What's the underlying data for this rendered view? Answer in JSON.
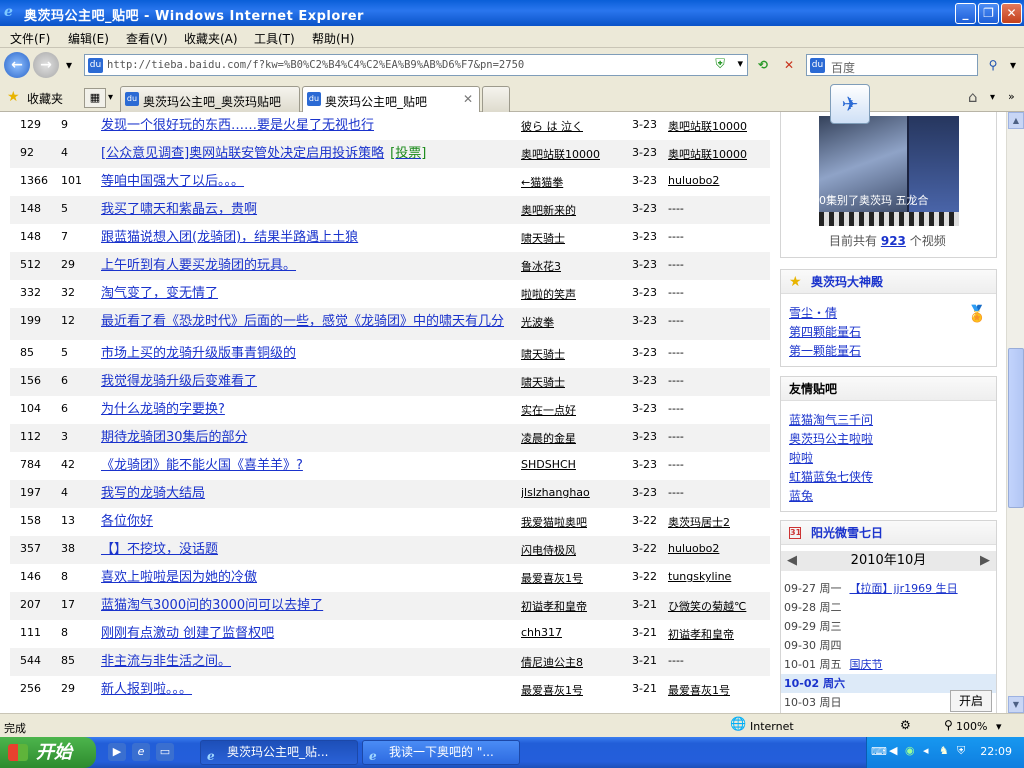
{
  "window": {
    "title": "奥茨玛公主吧_贴吧 - Windows Internet Explorer"
  },
  "menu": [
    "文件(F)",
    "编辑(E)",
    "查看(V)",
    "收藏夹(A)",
    "工具(T)",
    "帮助(H)"
  ],
  "address": {
    "url": "http://tieba.baidu.com/f?kw=%B0%C2%B4%C4%C2%EA%B9%AB%D6%F7&pn=2750"
  },
  "search": {
    "placeholder": "百度"
  },
  "favorites_label": "收藏夹",
  "tabs": [
    {
      "label": "奥茨玛公主吧_奥茨玛贴吧",
      "active": false
    },
    {
      "label": "奥茨玛公主吧_贴吧",
      "active": true
    }
  ],
  "threads": [
    {
      "replies": "129",
      "clicks": "9",
      "title": "发现一个很好玩的东西……要是火星了无视也行",
      "tag": "",
      "author": "彼ら は 泣く",
      "date": "3-23",
      "last": "奥吧站联10000"
    },
    {
      "replies": "92",
      "clicks": "4",
      "title": "[公众意见调查]奥网站联安管处决定启用投诉策略",
      "tag": "[投票]",
      "author": "奥吧站联10000",
      "date": "3-23",
      "last": "奥吧站联10000"
    },
    {
      "replies": "1366",
      "clicks": "101",
      "title": "等咱中国强大了以后。。。",
      "tag": "",
      "author": "←猫猫拳",
      "date": "3-23",
      "last": "huluobo2"
    },
    {
      "replies": "148",
      "clicks": "5",
      "title": "我买了啸天和紫晶云，贵啊",
      "tag": "",
      "author": "奥吧新来的",
      "date": "3-23",
      "last": "----"
    },
    {
      "replies": "148",
      "clicks": "7",
      "title": "跟蓝猫说想入团(龙骑团)，结果半路遇上土狼",
      "tag": "",
      "author": "啸天骑士",
      "date": "3-23",
      "last": "----"
    },
    {
      "replies": "512",
      "clicks": "29",
      "title": "上午听到有人要买龙骑团的玩具。",
      "tag": "",
      "author": "鲁冰花3",
      "date": "3-23",
      "last": "----"
    },
    {
      "replies": "332",
      "clicks": "32",
      "title": "淘气变了，变无情了",
      "tag": "",
      "author": "啦啦的笑声",
      "date": "3-23",
      "last": "----"
    },
    {
      "replies": "199",
      "clicks": "12",
      "title": "最近看了看《恐龙时代》后面的一些，感觉《龙骑团》中的啸天有几分",
      "tag": "",
      "author": "光波拳",
      "date": "3-23",
      "last": "----"
    },
    {
      "replies": "85",
      "clicks": "5",
      "title": "市场上买的龙骑升级版事青铜级的",
      "tag": "",
      "author": "啸天骑士",
      "date": "3-23",
      "last": "----"
    },
    {
      "replies": "156",
      "clicks": "6",
      "title": "我觉得龙骑升级后变难看了",
      "tag": "",
      "author": "啸天骑士",
      "date": "3-23",
      "last": "----"
    },
    {
      "replies": "104",
      "clicks": "6",
      "title": "为什么龙骑的字要换?",
      "tag": "",
      "author": "实在一点好",
      "date": "3-23",
      "last": "----"
    },
    {
      "replies": "112",
      "clicks": "3",
      "title": "期待龙骑团30集后的部分",
      "tag": "",
      "author": "凌晨的金星",
      "date": "3-23",
      "last": "----"
    },
    {
      "replies": "784",
      "clicks": "42",
      "title": "《龙骑团》能不能火国《喜羊羊》?",
      "tag": "",
      "author": "SHDSHCH",
      "date": "3-23",
      "last": "----"
    },
    {
      "replies": "197",
      "clicks": "4",
      "title": "我写的龙骑大结局",
      "tag": "",
      "author": "jlslzhanghao",
      "date": "3-23",
      "last": "----"
    },
    {
      "replies": "158",
      "clicks": "13",
      "title": "各位你好",
      "tag": "",
      "author": "我爱猫啦奥吧",
      "date": "3-22",
      "last": "奥茨玛居士2"
    },
    {
      "replies": "357",
      "clicks": "38",
      "title": "【】不挖坟，没话题",
      "tag": "",
      "author": "闪电侍极风",
      "date": "3-22",
      "last": "huluobo2"
    },
    {
      "replies": "146",
      "clicks": "8",
      "title": "喜欢上啦啦是因为她的冷傲",
      "tag": "",
      "author": "最爱喜灰1号",
      "date": "3-22",
      "last": "tungskyline"
    },
    {
      "replies": "207",
      "clicks": "17",
      "title": "蓝猫淘气3000问的3000问可以去掉了",
      "tag": "",
      "author": "初谥孝和皇帝",
      "date": "3-21",
      "last": "ひ微笑の菊越℃"
    },
    {
      "replies": "111",
      "clicks": "8",
      "title": "刚刚有点激动 创建了监督权吧",
      "tag": "",
      "author": "chh317",
      "date": "3-21",
      "last": "初谥孝和皇帝"
    },
    {
      "replies": "544",
      "clicks": "85",
      "title": "非主流与非生活之间。",
      "tag": "",
      "author": "倩尼迪公主8",
      "date": "3-21",
      "last": "----"
    },
    {
      "replies": "256",
      "clicks": "29",
      "title": "新人报到啦。。。",
      "tag": "",
      "author": "最爱喜灰1号",
      "date": "3-21",
      "last": "最爱喜灰1号"
    }
  ],
  "video": {
    "caption": "0集别了奥茨玛   五龙合",
    "count_prefix": "目前共有",
    "count": "923",
    "count_suffix": "个视频"
  },
  "temple": {
    "title": "奥茨玛大神殿",
    "items": [
      "雪尘・倩",
      "第四颗能量石",
      "第一颗能量石"
    ]
  },
  "friends": {
    "title": "友情贴吧",
    "items": [
      "蓝猫淘气三千问",
      "奥茨玛公主啦啦",
      "啦啦",
      "虹猫蓝兔七侠传",
      "蓝兔"
    ]
  },
  "calendar": {
    "title": "阳光微雪七日",
    "month": "2010年10月",
    "items": [
      {
        "day": "09-27 周一",
        "event": "【拉面】jjr1969 生日"
      },
      {
        "day": "09-28 周二",
        "event": ""
      },
      {
        "day": "09-29 周三",
        "event": ""
      },
      {
        "day": "09-30 周四",
        "event": ""
      },
      {
        "day": "10-01 周五",
        "event": "国庆节"
      },
      {
        "day": "10-02 周六",
        "event": ""
      },
      {
        "day": "10-03 周日",
        "event": ""
      }
    ]
  },
  "open_button": "开启",
  "status": {
    "text": "完成",
    "zone": "Internet",
    "zoom": "100%"
  },
  "taskbar": {
    "start": "开始",
    "buttons": [
      "奥茨玛公主吧_贴...",
      "我读一下奥吧的 \"..."
    ],
    "time": "22:09"
  }
}
